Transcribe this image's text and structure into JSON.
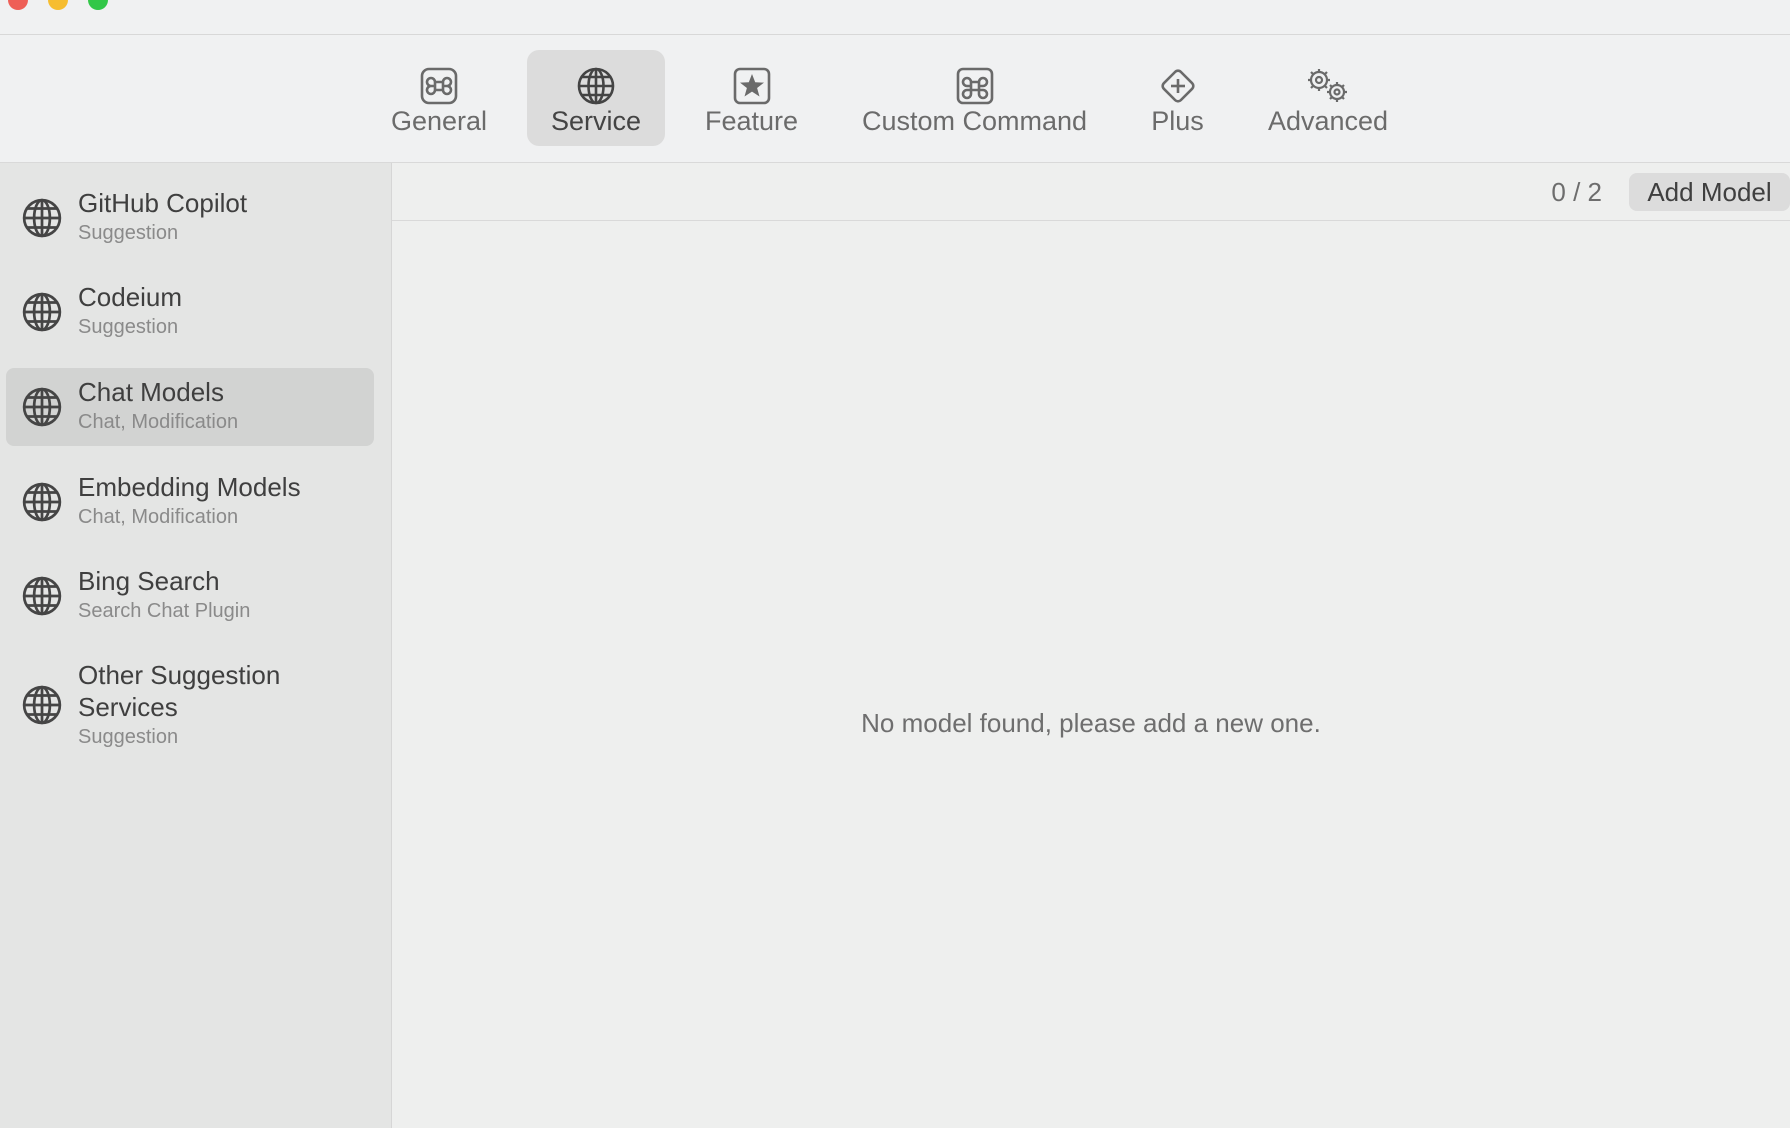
{
  "tabs": [
    {
      "label": "General",
      "icon": "command-square-icon"
    },
    {
      "label": "Service",
      "icon": "globe-icon"
    },
    {
      "label": "Feature",
      "icon": "star-square-icon"
    },
    {
      "label": "Custom Command",
      "icon": "command-icon"
    },
    {
      "label": "Plus",
      "icon": "plus-diamond-icon"
    },
    {
      "label": "Advanced",
      "icon": "gears-icon"
    }
  ],
  "active_tab": "Service",
  "sidebar": {
    "items": [
      {
        "title": "GitHub Copilot",
        "subtitle": "Suggestion"
      },
      {
        "title": "Codeium",
        "subtitle": "Suggestion"
      },
      {
        "title": "Chat Models",
        "subtitle": "Chat, Modification"
      },
      {
        "title": "Embedding Models",
        "subtitle": "Chat, Modification"
      },
      {
        "title": "Bing Search",
        "subtitle": "Search Chat Plugin"
      },
      {
        "title": "Other Suggestion Services",
        "subtitle": "Suggestion"
      }
    ],
    "selected": "Chat Models"
  },
  "main": {
    "counter": "0 / 2",
    "add_button": "Add Model",
    "empty_message": "No model found, please add a new one."
  }
}
